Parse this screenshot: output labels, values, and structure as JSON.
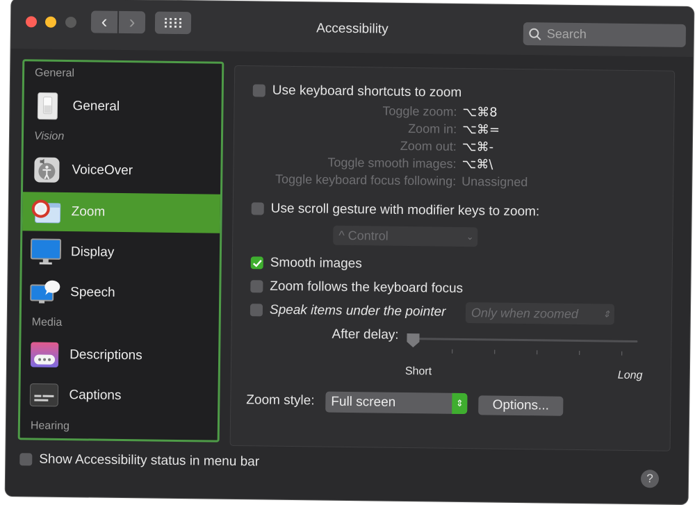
{
  "window": {
    "title": "Accessibility",
    "search_placeholder": "Search"
  },
  "sidebar": {
    "sections": {
      "general": "General",
      "vision": "Vision",
      "media": "Media",
      "hearing": "Hearing"
    },
    "items": [
      {
        "label": "General",
        "icon": "switch-icon"
      },
      {
        "label": "VoiceOver",
        "icon": "voiceover-icon"
      },
      {
        "label": "Zoom",
        "icon": "zoom-icon",
        "selected": true
      },
      {
        "label": "Display",
        "icon": "display-icon"
      },
      {
        "label": "Speech",
        "icon": "speech-icon"
      },
      {
        "label": "Descriptions",
        "icon": "descriptions-icon"
      },
      {
        "label": "Captions",
        "icon": "captions-icon"
      }
    ]
  },
  "zoom": {
    "keyboard_shortcuts": {
      "label": "Use keyboard shortcuts to zoom",
      "checked": false,
      "shortcuts": [
        {
          "label": "Toggle zoom:",
          "keys": "⌥⌘8"
        },
        {
          "label": "Zoom in:",
          "keys": "⌥⌘="
        },
        {
          "label": "Zoom out:",
          "keys": "⌥⌘-"
        },
        {
          "label": "Toggle smooth images:",
          "keys": "⌥⌘\\"
        },
        {
          "label": "Toggle keyboard focus following:",
          "keys": "Unassigned"
        }
      ]
    },
    "scroll_gesture": {
      "label": "Use scroll gesture with modifier keys to zoom:",
      "checked": false,
      "modifier": "^ Control"
    },
    "smooth_images": {
      "label": "Smooth images",
      "checked": true
    },
    "follow_focus": {
      "label": "Zoom follows the keyboard focus",
      "checked": false
    },
    "speak_items": {
      "label": "Speak items under the pointer",
      "checked": false,
      "mode": "Only when zoomed"
    },
    "delay": {
      "label": "After delay:",
      "min_label": "Short",
      "max_label": "Long",
      "value": 0
    },
    "zoom_style": {
      "label": "Zoom style:",
      "value": "Full screen",
      "options_button": "Options..."
    }
  },
  "footer": {
    "status_menu_label": "Show Accessibility status in menu bar",
    "status_menu_checked": false,
    "help": "?"
  },
  "colors": {
    "selection": "#4c9a2e",
    "checkbox_on": "#3fae2f",
    "sidebar_highlight_border": "#4e9b47"
  }
}
